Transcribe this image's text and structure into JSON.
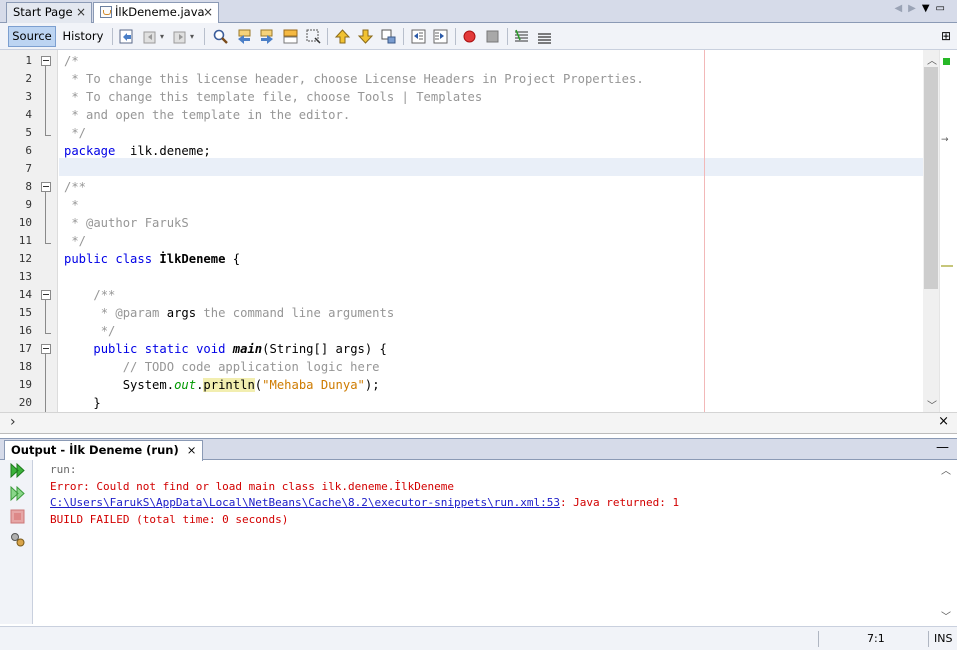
{
  "tabs": [
    {
      "label": "Start Page",
      "active": false
    },
    {
      "label": "İlkDeneme.java",
      "active": true
    }
  ],
  "toolbar": {
    "source_label": "Source",
    "history_label": "History"
  },
  "editor": {
    "line_numbers": [
      "1",
      "2",
      "3",
      "4",
      "5",
      "6",
      "7",
      "8",
      "9",
      "10",
      "11",
      "12",
      "13",
      "14",
      "15",
      "16",
      "17",
      "18",
      "19",
      "20"
    ],
    "lines": [
      [
        [
          "c-com",
          "/*"
        ]
      ],
      [
        [
          "c-com",
          " * To change this license header, choose License Headers in Project Properties."
        ]
      ],
      [
        [
          "c-com",
          " * To change this template file, choose Tools | Templates"
        ]
      ],
      [
        [
          "c-com",
          " * and open the template in the editor."
        ]
      ],
      [
        [
          "c-com",
          " */"
        ]
      ],
      [
        [
          "c-kw",
          "package"
        ],
        [
          "",
          "  i̇lk.deneme;"
        ]
      ],
      [],
      [
        [
          "c-com",
          "/**"
        ]
      ],
      [
        [
          "c-com",
          " *"
        ]
      ],
      [
        [
          "c-com",
          " * @author FarukS"
        ]
      ],
      [
        [
          "c-com",
          " */"
        ]
      ],
      [
        [
          "c-kw",
          "public class"
        ],
        [
          "",
          " "
        ],
        [
          "c-cls",
          "İlkDeneme"
        ],
        [
          "",
          " {"
        ]
      ],
      [],
      [
        [
          "",
          "    "
        ],
        [
          "c-com",
          "/**"
        ]
      ],
      [
        [
          "",
          "     "
        ],
        [
          "c-com",
          "* @param"
        ],
        [
          "",
          " args"
        ],
        [
          "c-com",
          " the command line arguments"
        ]
      ],
      [
        [
          "",
          "     "
        ],
        [
          "c-com",
          "*/"
        ]
      ],
      [
        [
          "",
          "    "
        ],
        [
          "c-kw",
          "public static void"
        ],
        [
          "",
          " "
        ],
        [
          "c-mth",
          "main"
        ],
        [
          "",
          "(String[] args) {"
        ]
      ],
      [
        [
          "",
          "        "
        ],
        [
          "c-com",
          "// TODO code application logic here"
        ]
      ],
      [
        [
          "",
          "        System."
        ],
        [
          "c-fld",
          "out"
        ],
        [
          "",
          "."
        ],
        [
          "c-hl",
          "println"
        ],
        [
          "",
          "("
        ],
        [
          "c-str",
          "\"Mehaba Dunya\""
        ],
        [
          "",
          ");"
        ]
      ],
      [
        [
          "",
          "    }"
        ]
      ]
    ]
  },
  "output": {
    "tab_label": "Output - İlk Deneme (run)",
    "lines": {
      "run": "run:",
      "error": "Error: Could not find or load main class i̇lk.deneme.İlkDeneme",
      "path_link": "C:\\Users\\FarukS\\AppData\\Local\\NetBeans\\Cache\\8.2\\executor-snippets\\run.xml:53",
      "path_suffix": ": Java returned: 1",
      "build": "BUILD FAILED (total time: 0 seconds)"
    }
  },
  "status": {
    "position": "7:1",
    "mode": "INS"
  },
  "colors": {
    "keyword": "#0000e6",
    "comment": "#969696",
    "string": "#ce7b00",
    "error": "#d20000",
    "link": "#1c1cc8"
  },
  "icons": {
    "close": "×",
    "expand": "⊞",
    "minimize": "—"
  }
}
